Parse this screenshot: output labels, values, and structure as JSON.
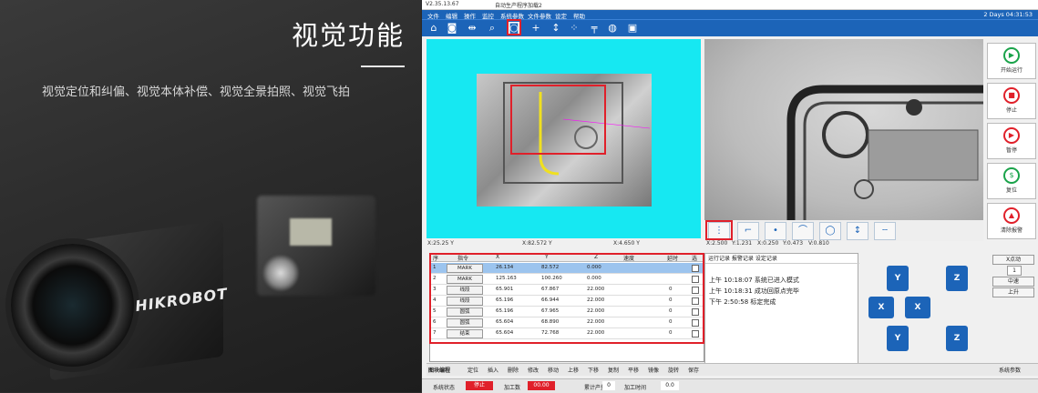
{
  "promo": {
    "title": "视觉功能",
    "subtitle": "视觉定位和纠偏、视觉本体补偿、视觉全景拍照、视觉飞拍",
    "brand": "HIKROBOT"
  },
  "app": {
    "titlebar": {
      "left": "V2.35.13.67",
      "center": "自动生产程序加载2",
      "right": "系统运行 第1天"
    },
    "menu": [
      "文件",
      "编辑",
      "操作",
      "监控",
      "系统参数",
      "文件参数",
      "设定",
      "帮助"
    ],
    "status_right": "2 Days 04:31:53",
    "toolbar_icons": [
      "home-icon",
      "camera-icon",
      "move-icon",
      "search-icon",
      "camera-capture-icon",
      "cross-icon",
      "vertical-icon",
      "grid-icon",
      "level-icon",
      "globe-icon",
      "image-icon"
    ],
    "side_buttons": [
      {
        "label": "开始运行",
        "icon": "play-icon",
        "color": "#1aa34a",
        "glyph": "▶"
      },
      {
        "label": "停止",
        "icon": "stop-icon",
        "color": "#e0202a",
        "glyph": "■"
      },
      {
        "label": "暂停",
        "icon": "pause-icon",
        "color": "#e0202a",
        "glyph": "▶"
      },
      {
        "label": "复位",
        "icon": "reset-icon",
        "color": "#1aa34a",
        "glyph": "$"
      },
      {
        "label": "清除报警",
        "icon": "alarm-icon",
        "color": "#e0202a",
        "glyph": "▲"
      }
    ],
    "coords_left": [
      "X:25.25 Y",
      "X:82.572 Y",
      "X:4.650 Y"
    ],
    "coords_right": [
      "X:2.500",
      "Y:1.231",
      "X:0.250",
      "Y:0.473",
      "V:0.810"
    ],
    "table": {
      "headers": [
        "序",
        "指令",
        "X",
        "Y",
        "Z",
        "速度",
        "延时",
        "选"
      ],
      "rows": [
        {
          "n": "1",
          "cmd": "MARK",
          "x": "26.134",
          "y": "82.572",
          "z": "0.000",
          "speed": "",
          "delay": ""
        },
        {
          "n": "2",
          "cmd": "MARK",
          "x": "125.163",
          "y": "100.260",
          "z": "0.000",
          "speed": "",
          "delay": ""
        },
        {
          "n": "3",
          "cmd": "线段",
          "x": "65.901",
          "y": "67.867",
          "z": "22.000",
          "speed": "",
          "delay": "0"
        },
        {
          "n": "4",
          "cmd": "线段",
          "x": "65.196",
          "y": "66.944",
          "z": "22.000",
          "speed": "",
          "delay": "0"
        },
        {
          "n": "5",
          "cmd": "圆弧",
          "x": "65.196",
          "y": "67.965",
          "z": "22.000",
          "speed": "",
          "delay": "0"
        },
        {
          "n": "6",
          "cmd": "圆弧",
          "x": "65.604",
          "y": "68.890",
          "z": "22.000",
          "speed": "",
          "delay": "0"
        },
        {
          "n": "7",
          "cmd": "结束",
          "x": "65.604",
          "y": "72.768",
          "z": "22.000",
          "speed": "",
          "delay": "0"
        }
      ]
    },
    "log": {
      "header": "运行记录  报警记录  设定记录",
      "lines": [
        "上午 10:18:07 系统已进入模式",
        "上午 10:18:31 成功回原点完毕",
        "下午 2:50:58 标定完成"
      ]
    },
    "jog": {
      "y_plus": "Y",
      "z_plus": "Z",
      "x_minus": "X",
      "x_plus": "X",
      "y_minus": "Y",
      "z_minus": "Z"
    },
    "right_controls": {
      "select": "X点动",
      "speed_value": "1",
      "mid": "中速",
      "up": "上升"
    },
    "tabs": [
      "图块编程",
      "定位",
      "插入",
      "删除",
      "修改",
      "移动",
      "上移",
      "下移",
      "复制",
      "平移",
      "镜像",
      "旋转",
      "保存"
    ],
    "tab_right": "系统参数",
    "status": {
      "label1": "系统状态",
      "value1": "停止",
      "label2": "加工数",
      "value2": "00.00",
      "label3": "累计产量",
      "value3": "0",
      "label4": "加工时间",
      "value4": "0.0"
    }
  }
}
